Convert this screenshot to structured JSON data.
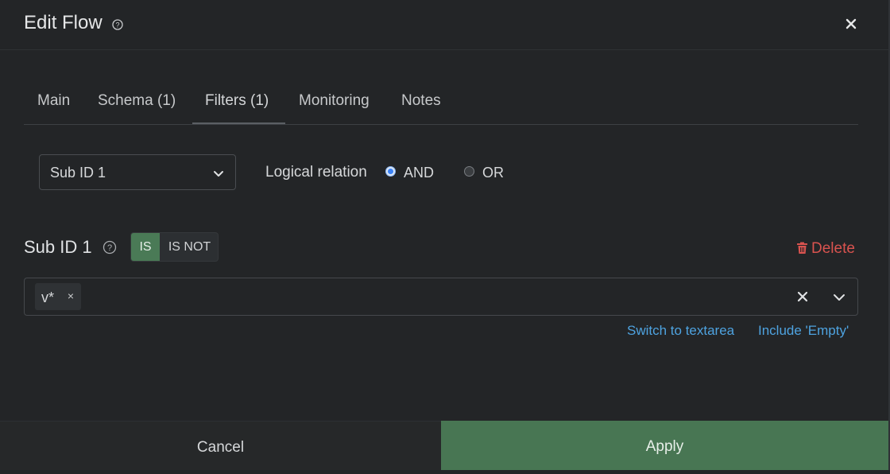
{
  "header": {
    "title": "Edit Flow",
    "help_icon": "help-circle-icon",
    "close_icon": "close-icon"
  },
  "tabs": [
    {
      "label": "Main",
      "active": false
    },
    {
      "label": "Schema (1)",
      "active": false
    },
    {
      "label": "Filters (1)",
      "active": true
    },
    {
      "label": "Monitoring",
      "active": false
    },
    {
      "label": "Notes",
      "active": false
    }
  ],
  "filter_select": {
    "value": "Sub ID 1"
  },
  "logical_relation": {
    "label": "Logical relation",
    "options": [
      {
        "label": "AND",
        "selected": true
      },
      {
        "label": "OR",
        "selected": false
      }
    ]
  },
  "filter": {
    "title": "Sub ID 1",
    "mode": {
      "is_label": "IS",
      "is_not_label": "IS NOT",
      "active": "IS"
    },
    "delete_label": "Delete",
    "tags": [
      "v*"
    ]
  },
  "links": {
    "switch_textarea": "Switch to textarea",
    "include_empty": "Include 'Empty'"
  },
  "footer": {
    "cancel_label": "Cancel",
    "apply_label": "Apply"
  },
  "colors": {
    "background": "#232527",
    "accent_green": "#487653",
    "link_blue": "#4ea3e0",
    "delete_red": "#d9534f"
  }
}
